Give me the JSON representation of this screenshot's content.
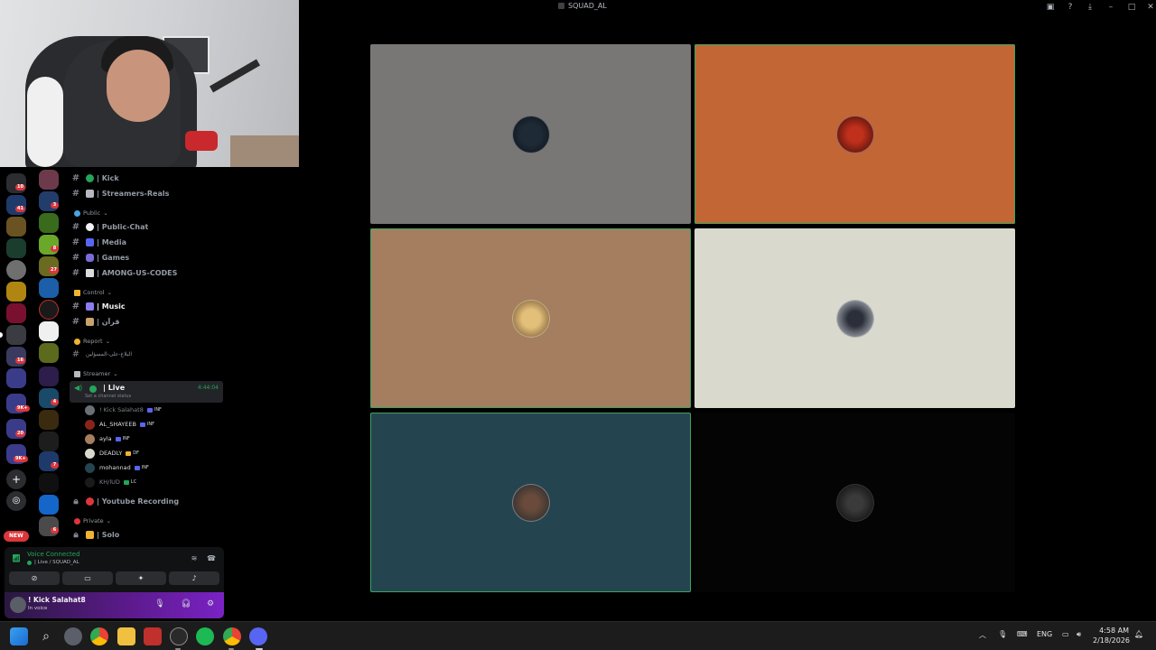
{
  "window": {
    "title": "SQUAD_AL",
    "controls": [
      "screen-share-icon",
      "help-icon",
      "download-icon",
      "minimize",
      "maximize",
      "close"
    ],
    "minimize_glyph": "–",
    "maximize_glyph": "□",
    "close_glyph": "✕"
  },
  "server_rail": {
    "badges": [
      "10",
      "41",
      "3",
      "8",
      "27",
      "16",
      "9K+",
      "20",
      "9K+",
      "4",
      "7",
      "6"
    ],
    "new_label": "NEW"
  },
  "channels": {
    "items": [
      {
        "label": "| Kick"
      },
      {
        "label": "| Streamers-Reals"
      }
    ],
    "categories": {
      "public": "Public",
      "control": "Control",
      "report": "Report",
      "streamer": "Streamer",
      "private": "Private"
    },
    "public_items": [
      {
        "label": "| Public-Chat"
      },
      {
        "label": "| Media"
      },
      {
        "label": "| Games"
      },
      {
        "label": "| AMONG-US-CODES"
      }
    ],
    "control_items": [
      {
        "label": "| Music"
      },
      {
        "label": "| قرآن"
      }
    ],
    "report_items": [
      {
        "label": "البلاغ-على-المسؤلين"
      }
    ],
    "live": {
      "name": "| Live",
      "status": "Set a channel status",
      "time": "4:44:04"
    },
    "members": [
      {
        "name": "! Kick Salahat8",
        "tag": "INF"
      },
      {
        "name": "AL_SHAYEEB",
        "tag": "INF"
      },
      {
        "name": "ayla",
        "tag": "INF"
      },
      {
        "name": "DEADLY",
        "tag": "DF"
      },
      {
        "name": "mohannad",
        "tag": "INF"
      },
      {
        "name": "KH/lUD",
        "tag": "LC"
      }
    ],
    "youtube": "| Youtube Recording",
    "solo": "| Solo"
  },
  "voice_panel": {
    "status": "Voice Connected",
    "location": "| Live / SQUAD_AL"
  },
  "user_panel": {
    "name": "! Kick Salahat8",
    "status": "In voice"
  },
  "video_tiles": [
    {
      "name": "tile-1",
      "bg": "#797775"
    },
    {
      "name": "tile-2",
      "bg": "#c26636"
    },
    {
      "name": "tile-3",
      "bg": "#a47e5f"
    },
    {
      "name": "tile-4",
      "bg": "#d9d9cd"
    },
    {
      "name": "tile-5",
      "bg": "#244450"
    },
    {
      "name": "tile-6",
      "bg": "#040404"
    }
  ],
  "taskbar": {
    "language": "ENG",
    "time": "4:58 AM",
    "date": "2/18/2026"
  },
  "colors": {
    "accent_green": "#23a55a",
    "danger_red": "#da373c",
    "blurple": "#5865f2"
  }
}
